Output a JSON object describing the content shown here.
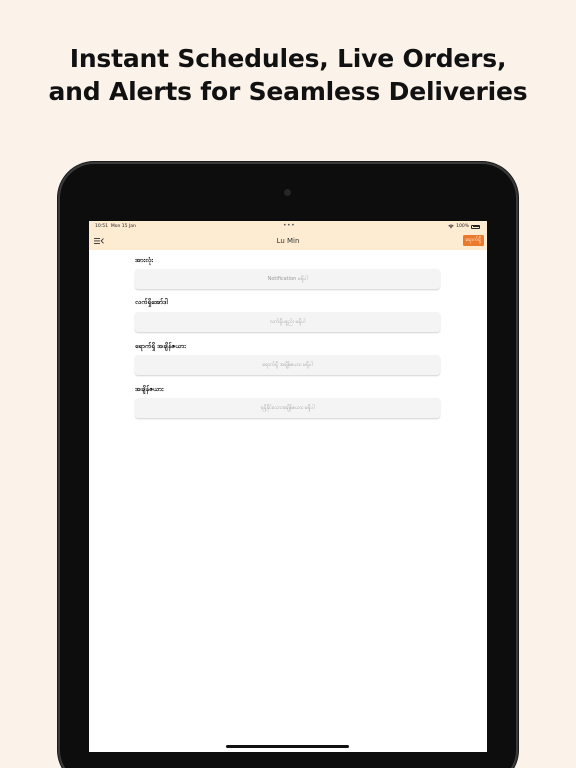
{
  "headline": {
    "line1": "Instant Schedules, Live Orders,",
    "line2": "and Alerts for Seamless Deliveries"
  },
  "statusbar": {
    "time": "10:51",
    "date": "Mon 15 Jan",
    "dots": "•••",
    "battery": "100%"
  },
  "navbar": {
    "title": "Lu Min",
    "menu_icon": "menu-icon",
    "action_label": "ရောက်ရှိ",
    "accent": "#ec7a2d",
    "background": "#fdebd2"
  },
  "sections": [
    {
      "label": "အားလုံး",
      "placeholder": "Notification မရှိပါ"
    },
    {
      "label": "လက်ရှိအော်ဒါ",
      "placeholder": "လက်ရှိပစ္စည်း မရှိပါ"
    },
    {
      "label": "ရောက်ရှိ အချိန်ဇယား",
      "placeholder": "ရောက်ရှိ အချိန်ဇယား မရှိပါ"
    },
    {
      "label": "အချိန်ဇယား",
      "placeholder": "ရရှိနိုင်သောအချိန်ဇယား မရှိပါ"
    }
  ]
}
